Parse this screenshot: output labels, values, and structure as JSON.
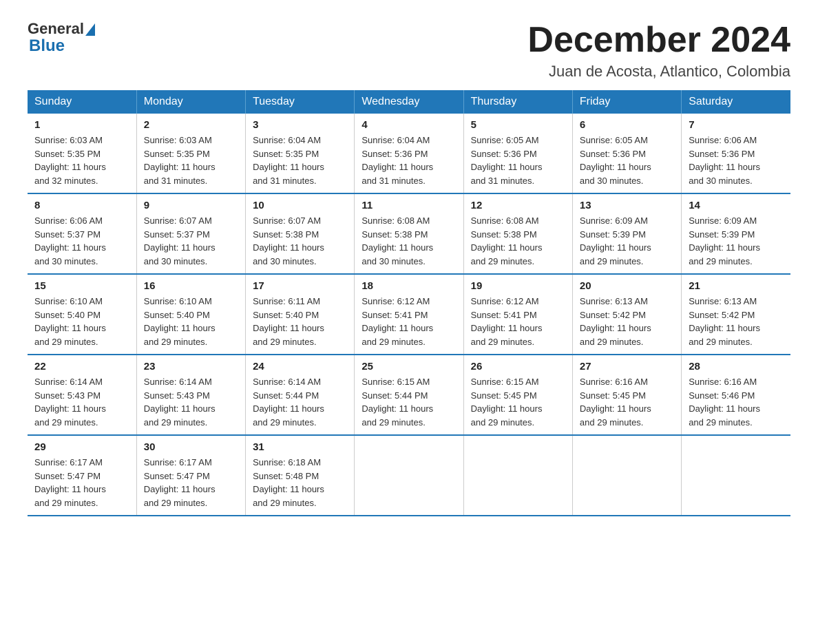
{
  "header": {
    "logo_line1": "General",
    "logo_line2": "Blue",
    "title": "December 2024",
    "subtitle": "Juan de Acosta, Atlantico, Colombia"
  },
  "days_of_week": [
    "Sunday",
    "Monday",
    "Tuesday",
    "Wednesday",
    "Thursday",
    "Friday",
    "Saturday"
  ],
  "weeks": [
    [
      {
        "day": "1",
        "sunrise": "6:03 AM",
        "sunset": "5:35 PM",
        "daylight": "11 hours and 32 minutes."
      },
      {
        "day": "2",
        "sunrise": "6:03 AM",
        "sunset": "5:35 PM",
        "daylight": "11 hours and 31 minutes."
      },
      {
        "day": "3",
        "sunrise": "6:04 AM",
        "sunset": "5:35 PM",
        "daylight": "11 hours and 31 minutes."
      },
      {
        "day": "4",
        "sunrise": "6:04 AM",
        "sunset": "5:36 PM",
        "daylight": "11 hours and 31 minutes."
      },
      {
        "day": "5",
        "sunrise": "6:05 AM",
        "sunset": "5:36 PM",
        "daylight": "11 hours and 31 minutes."
      },
      {
        "day": "6",
        "sunrise": "6:05 AM",
        "sunset": "5:36 PM",
        "daylight": "11 hours and 30 minutes."
      },
      {
        "day": "7",
        "sunrise": "6:06 AM",
        "sunset": "5:36 PM",
        "daylight": "11 hours and 30 minutes."
      }
    ],
    [
      {
        "day": "8",
        "sunrise": "6:06 AM",
        "sunset": "5:37 PM",
        "daylight": "11 hours and 30 minutes."
      },
      {
        "day": "9",
        "sunrise": "6:07 AM",
        "sunset": "5:37 PM",
        "daylight": "11 hours and 30 minutes."
      },
      {
        "day": "10",
        "sunrise": "6:07 AM",
        "sunset": "5:38 PM",
        "daylight": "11 hours and 30 minutes."
      },
      {
        "day": "11",
        "sunrise": "6:08 AM",
        "sunset": "5:38 PM",
        "daylight": "11 hours and 30 minutes."
      },
      {
        "day": "12",
        "sunrise": "6:08 AM",
        "sunset": "5:38 PM",
        "daylight": "11 hours and 29 minutes."
      },
      {
        "day": "13",
        "sunrise": "6:09 AM",
        "sunset": "5:39 PM",
        "daylight": "11 hours and 29 minutes."
      },
      {
        "day": "14",
        "sunrise": "6:09 AM",
        "sunset": "5:39 PM",
        "daylight": "11 hours and 29 minutes."
      }
    ],
    [
      {
        "day": "15",
        "sunrise": "6:10 AM",
        "sunset": "5:40 PM",
        "daylight": "11 hours and 29 minutes."
      },
      {
        "day": "16",
        "sunrise": "6:10 AM",
        "sunset": "5:40 PM",
        "daylight": "11 hours and 29 minutes."
      },
      {
        "day": "17",
        "sunrise": "6:11 AM",
        "sunset": "5:40 PM",
        "daylight": "11 hours and 29 minutes."
      },
      {
        "day": "18",
        "sunrise": "6:12 AM",
        "sunset": "5:41 PM",
        "daylight": "11 hours and 29 minutes."
      },
      {
        "day": "19",
        "sunrise": "6:12 AM",
        "sunset": "5:41 PM",
        "daylight": "11 hours and 29 minutes."
      },
      {
        "day": "20",
        "sunrise": "6:13 AM",
        "sunset": "5:42 PM",
        "daylight": "11 hours and 29 minutes."
      },
      {
        "day": "21",
        "sunrise": "6:13 AM",
        "sunset": "5:42 PM",
        "daylight": "11 hours and 29 minutes."
      }
    ],
    [
      {
        "day": "22",
        "sunrise": "6:14 AM",
        "sunset": "5:43 PM",
        "daylight": "11 hours and 29 minutes."
      },
      {
        "day": "23",
        "sunrise": "6:14 AM",
        "sunset": "5:43 PM",
        "daylight": "11 hours and 29 minutes."
      },
      {
        "day": "24",
        "sunrise": "6:14 AM",
        "sunset": "5:44 PM",
        "daylight": "11 hours and 29 minutes."
      },
      {
        "day": "25",
        "sunrise": "6:15 AM",
        "sunset": "5:44 PM",
        "daylight": "11 hours and 29 minutes."
      },
      {
        "day": "26",
        "sunrise": "6:15 AM",
        "sunset": "5:45 PM",
        "daylight": "11 hours and 29 minutes."
      },
      {
        "day": "27",
        "sunrise": "6:16 AM",
        "sunset": "5:45 PM",
        "daylight": "11 hours and 29 minutes."
      },
      {
        "day": "28",
        "sunrise": "6:16 AM",
        "sunset": "5:46 PM",
        "daylight": "11 hours and 29 minutes."
      }
    ],
    [
      {
        "day": "29",
        "sunrise": "6:17 AM",
        "sunset": "5:47 PM",
        "daylight": "11 hours and 29 minutes."
      },
      {
        "day": "30",
        "sunrise": "6:17 AM",
        "sunset": "5:47 PM",
        "daylight": "11 hours and 29 minutes."
      },
      {
        "day": "31",
        "sunrise": "6:18 AM",
        "sunset": "5:48 PM",
        "daylight": "11 hours and 29 minutes."
      },
      {
        "day": "",
        "sunrise": "",
        "sunset": "",
        "daylight": ""
      },
      {
        "day": "",
        "sunrise": "",
        "sunset": "",
        "daylight": ""
      },
      {
        "day": "",
        "sunrise": "",
        "sunset": "",
        "daylight": ""
      },
      {
        "day": "",
        "sunrise": "",
        "sunset": "",
        "daylight": ""
      }
    ]
  ],
  "labels": {
    "sunrise": "Sunrise:",
    "sunset": "Sunset:",
    "daylight": "Daylight:"
  }
}
